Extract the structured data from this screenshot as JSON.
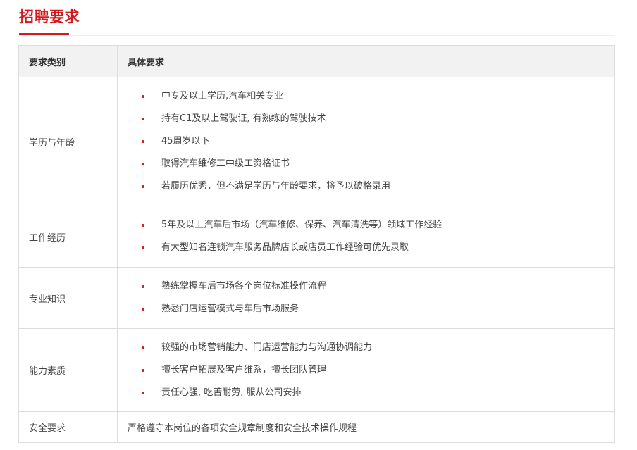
{
  "header": {
    "title": "招聘要求"
  },
  "table": {
    "columns": [
      "要求类别",
      "具体要求"
    ],
    "rows": [
      {
        "category": "学历与年龄",
        "items": [
          "中专及以上学历,汽车相关专业",
          "持有C1及以上驾驶证, 有熟练的驾驶技术",
          "45周岁以下",
          "取得汽车维修工中级工资格证书",
          "若履历优秀，但不满足学历与年龄要求，将予以破格录用"
        ]
      },
      {
        "category": "工作经历",
        "items": [
          "5年及以上汽车后市场（汽车维修、保养、汽车清洗等）领域工作经验",
          "有大型知名连锁汽车服务品牌店长或店员工作经验可优先录取"
        ]
      },
      {
        "category": "专业知识",
        "items": [
          "熟练掌握车后市场各个岗位标准操作流程",
          "熟悉门店运营模式与车后市场服务"
        ]
      },
      {
        "category": "能力素质",
        "items": [
          "较强的市场营销能力、门店运营能力与沟通协调能力",
          "擅长客户拓展及客户维系，擅长团队管理",
          "责任心强, 吃苦耐劳, 服从公司安排"
        ]
      },
      {
        "category": "安全要求",
        "text": "严格遵守本岗位的各项安全规章制度和安全技术操作规程"
      }
    ]
  },
  "colors": {
    "accent": "#d21a1f",
    "header_bg": "#f2f2f2",
    "border": "#dddddd"
  }
}
